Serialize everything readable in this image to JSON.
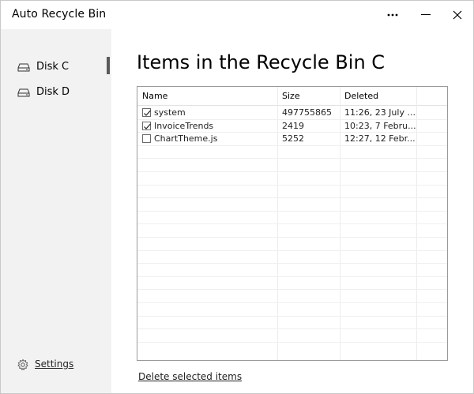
{
  "app": {
    "title": "Auto Recycle Bin"
  },
  "titlebar": {
    "more_icon": "more-horizontal-icon",
    "minimize_icon": "minimize-icon",
    "close_icon": "close-icon"
  },
  "sidebar": {
    "items": [
      {
        "label": "Disk C",
        "icon": "drive-icon",
        "active": true
      },
      {
        "label": "Disk D",
        "icon": "drive-icon",
        "active": false
      }
    ],
    "settings": {
      "label": "Settings",
      "icon": "gear-icon"
    }
  },
  "main": {
    "title": "Items in the Recycle Bin C",
    "table": {
      "columns": [
        "Name",
        "Size",
        "Deleted"
      ],
      "rows": [
        {
          "checked": true,
          "name": "system",
          "size": "497755865",
          "deleted": "11:26, 23 July ..."
        },
        {
          "checked": true,
          "name": "InvoiceTrends",
          "size": "2419",
          "deleted": "10:23, 7 Febru..."
        },
        {
          "checked": false,
          "name": "ChartTheme.js",
          "size": "5252",
          "deleted": "12:27, 12 Febr..."
        }
      ]
    },
    "delete_label": "Delete selected items"
  },
  "colors": {
    "sidebar_bg": "#f2f2f2",
    "active_indicator": "#5a5a5a",
    "table_border": "#9a9a9a",
    "grid_line": "#ececec"
  }
}
